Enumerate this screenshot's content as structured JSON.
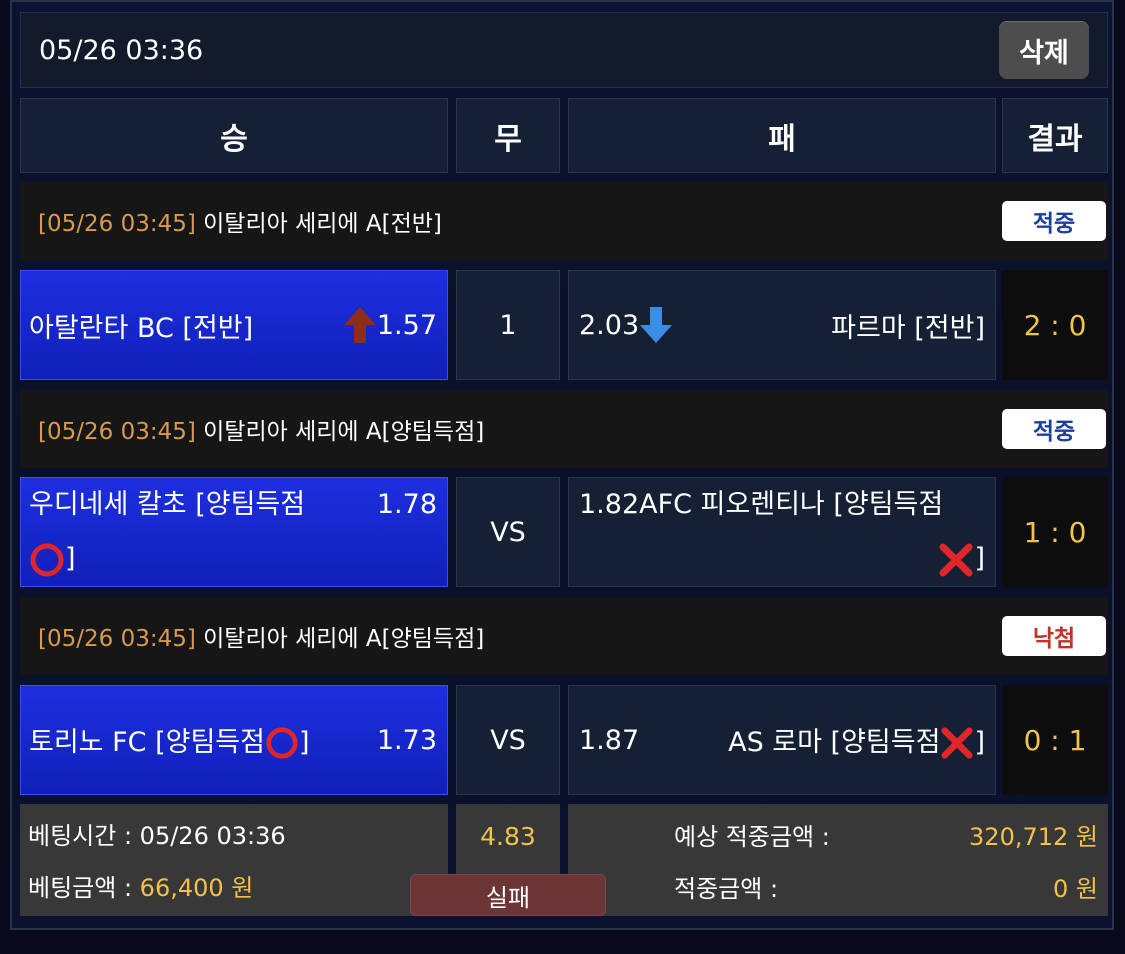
{
  "header": {
    "datetime": "05/26 03:36",
    "delete_label": "삭제"
  },
  "columns": {
    "win": "승",
    "draw": "무",
    "lose": "패",
    "result": "결과"
  },
  "matches": [
    {
      "league_time": "[05/26 03:45]",
      "league_name": " 이탈리아 세리에 A[전반]",
      "status": "적중",
      "status_color": "#1a3fa0",
      "home": "아탈란타 BC [전반]",
      "home_odds": "1.57",
      "home_arrow": "up-arrow-icon",
      "draw": "1",
      "away_odds": "2.03",
      "away_arrow": "down-arrow-icon",
      "away": "파르마 [전반]",
      "score": "2 : 0"
    },
    {
      "league_time": "[05/26 03:45]",
      "league_name": " 이탈리아 세리에 A[양팀득점]",
      "status": "적중",
      "status_color": "#1a3fa0",
      "home_line1": "우디네세 칼초 [양팀득점",
      "home_line2": "]",
      "home_odds": "1.78",
      "home_symbol": "circle-icon",
      "draw": "VS",
      "away_odds": "1.82",
      "away_line1": "AFC 피오렌티나 [양팀득점",
      "away_line2": "]",
      "away_symbol": "x-icon",
      "score": "1 : 0"
    },
    {
      "league_time": "[05/26 03:45]",
      "league_name": " 이탈리아 세리에 A[양팀득점]",
      "status": "낙첨",
      "status_color": "#c0322a",
      "home": "토리노 FC [양팀득점",
      "home_end": "]",
      "home_odds": "1.73",
      "draw": "VS",
      "away_odds": "1.87",
      "away": "AS 로마 [양팀득점",
      "away_end": "]",
      "score": "0 : 1"
    }
  ],
  "summary": {
    "bet_time_label": "베팅시간 : ",
    "bet_time": "05/26 03:36",
    "bet_amount_label": "베팅금액 : ",
    "bet_amount": "66,400 원",
    "total_odds": "4.83",
    "fail_label": "실패",
    "expected_label": "예상 적중금액 :",
    "expected_value": "320,712 원",
    "win_label": "적중금액 :",
    "win_value": "0 원"
  }
}
